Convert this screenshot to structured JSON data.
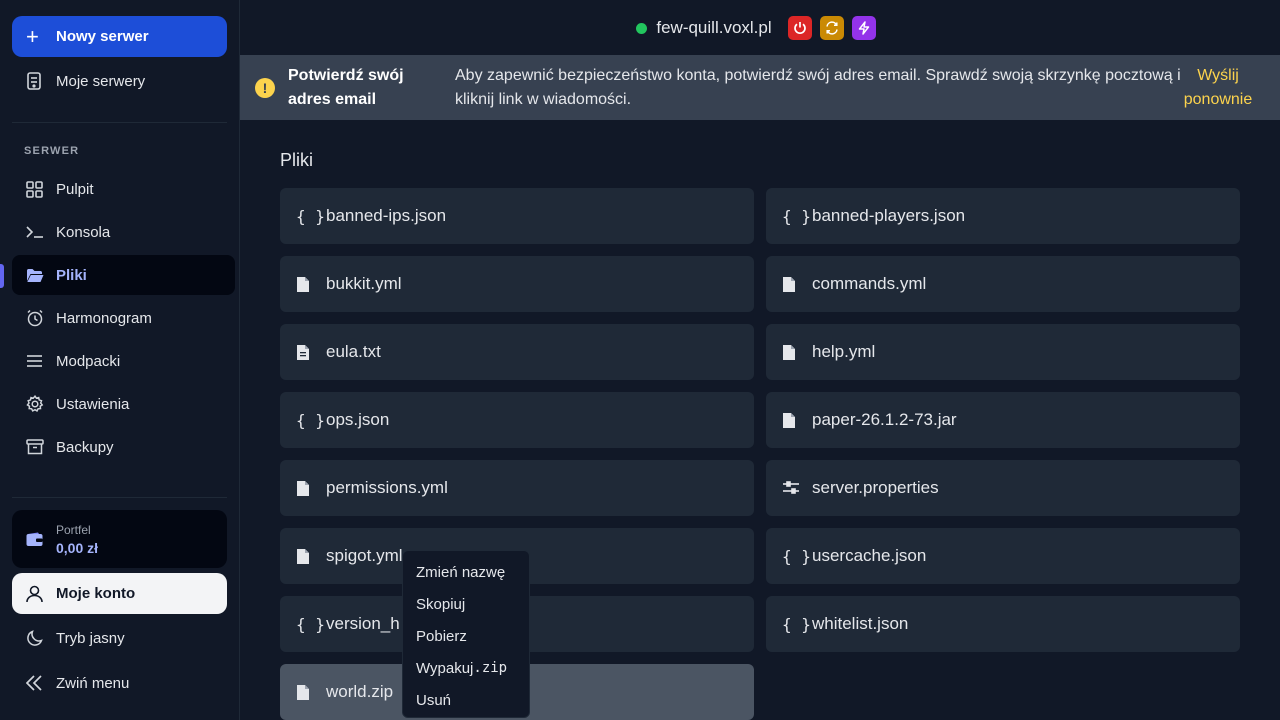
{
  "sidebar": {
    "new_server": "Nowy serwer",
    "my_servers": "Moje serwery",
    "section_label": "SERWER",
    "items": [
      {
        "label": "Pulpit",
        "icon": "grid-icon"
      },
      {
        "label": "Konsola",
        "icon": "terminal-icon"
      },
      {
        "label": "Pliki",
        "icon": "folder-open-icon",
        "active": true
      },
      {
        "label": "Harmonogram",
        "icon": "alarm-clock-icon"
      },
      {
        "label": "Modpacki",
        "icon": "menu-lines-icon"
      },
      {
        "label": "Ustawienia",
        "icon": "gear-icon"
      },
      {
        "label": "Backupy",
        "icon": "archive-icon"
      }
    ],
    "wallet": {
      "label": "Portfel",
      "value": "0,00 zł"
    },
    "account": "Moje konto",
    "theme_toggle": "Tryb jasny",
    "collapse": "Zwiń menu"
  },
  "topbar": {
    "hostname": "few-quill.voxl.pl",
    "status": "online",
    "colors": {
      "power": "#dc2626",
      "restart": "#ca8a04",
      "kill": "#9333ea",
      "status": "#22c55e"
    }
  },
  "banner": {
    "title": "Potwierdź swój adres email",
    "text": "Aby zapewnić bezpieczeństwo konta, potwierdź swój adres email. Sprawdź swoją skrzynkę pocztową i kliknij link w wiadomości.",
    "link": "Wyślij ponownie"
  },
  "main": {
    "title": "Pliki",
    "files": [
      {
        "name": "banned-ips.json",
        "icon": "json-braces-icon"
      },
      {
        "name": "banned-players.json",
        "icon": "json-braces-icon"
      },
      {
        "name": "bukkit.yml",
        "icon": "file-icon"
      },
      {
        "name": "commands.yml",
        "icon": "file-icon"
      },
      {
        "name": "eula.txt",
        "icon": "file-text-icon"
      },
      {
        "name": "help.yml",
        "icon": "file-icon"
      },
      {
        "name": "ops.json",
        "icon": "json-braces-icon"
      },
      {
        "name": "paper-26.1.2-73.jar",
        "icon": "file-icon"
      },
      {
        "name": "permissions.yml",
        "icon": "file-icon"
      },
      {
        "name": "server.properties",
        "icon": "sliders-icon"
      },
      {
        "name": "spigot.yml",
        "icon": "file-icon"
      },
      {
        "name": "usercache.json",
        "icon": "json-braces-icon"
      },
      {
        "name": "version_h",
        "icon": "json-braces-icon"
      },
      {
        "name": "whitelist.json",
        "icon": "json-braces-icon"
      },
      {
        "name": "world.zip",
        "icon": "file-icon",
        "selected": true
      }
    ]
  },
  "context_menu": {
    "rename": "Zmień nazwę",
    "copy": "Skopiuj",
    "download": "Pobierz",
    "extract_prefix": "Wypakuj",
    "extract_ext": ".zip",
    "delete": "Usuń"
  }
}
